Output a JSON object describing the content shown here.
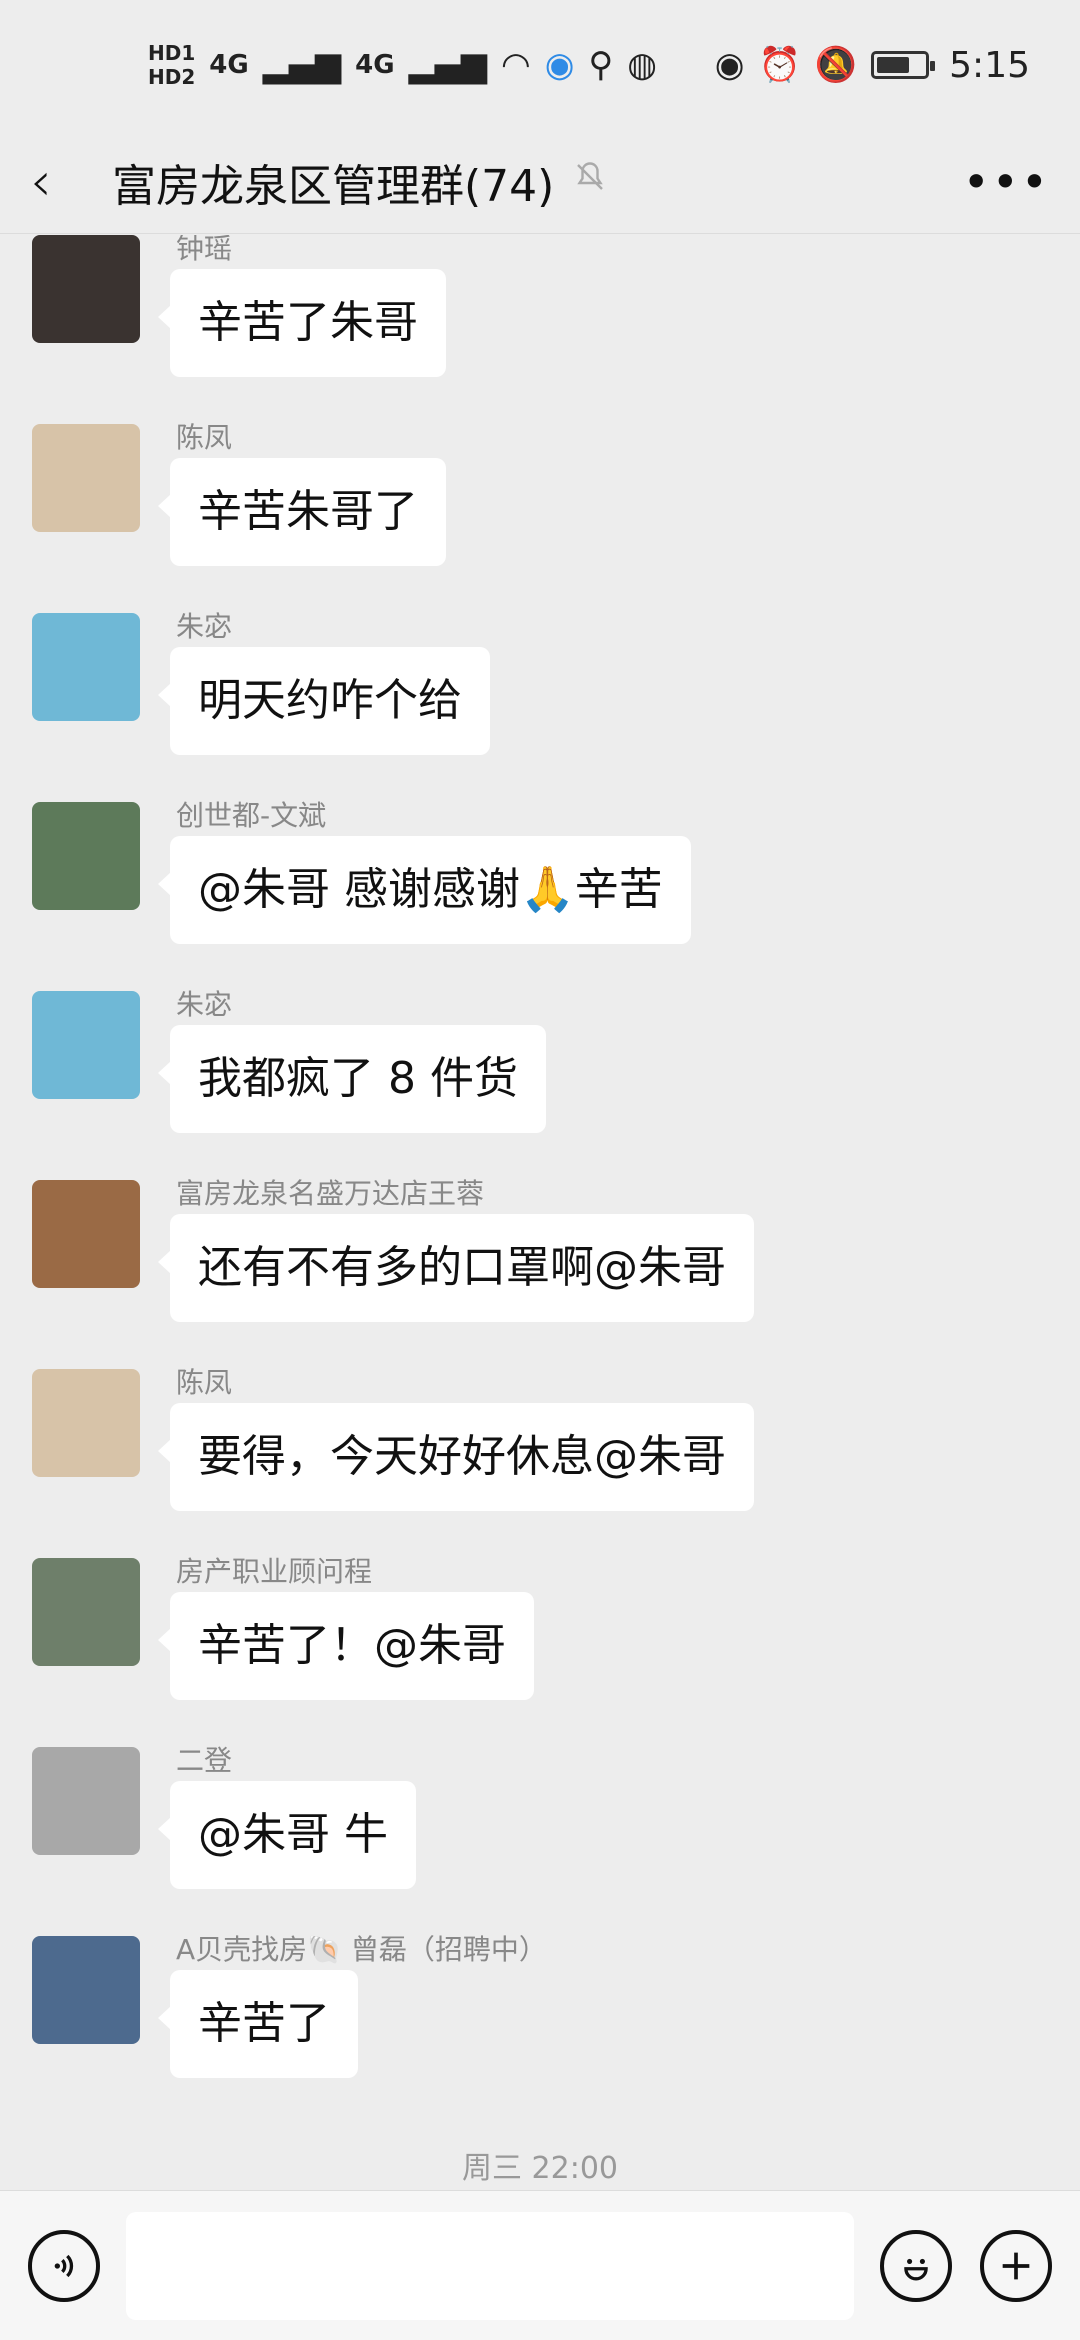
{
  "status_bar": {
    "hd1": "HD1",
    "hd2": "HD2",
    "signal1": "4G",
    "signal2": "4G",
    "time": "5:15"
  },
  "header": {
    "title": "富房龙泉区管理群(74)"
  },
  "messages": [
    {
      "sender": "钟瑶",
      "text": "辛苦了朱哥",
      "avatar_color": "#3a3330"
    },
    {
      "sender": "陈凤",
      "text": "辛苦朱哥了",
      "avatar_color": "#d7c3a8"
    },
    {
      "sender": "朱宓",
      "text": "明天约咋个给",
      "avatar_color": "#6fb8d6"
    },
    {
      "sender": "创世都-文斌",
      "text": "@朱哥  感谢感谢🙏辛苦",
      "avatar_color": "#5d7a5a"
    },
    {
      "sender": "朱宓",
      "text": "我都疯了 8 件货",
      "avatar_color": "#6fb8d6"
    },
    {
      "sender": "富房龙泉名盛万达店王蓉",
      "text": "还有不有多的口罩啊@朱哥",
      "avatar_color": "#9a6a45"
    },
    {
      "sender": "陈凤",
      "text": "要得，今天好好休息@朱哥",
      "avatar_color": "#d7c3a8"
    },
    {
      "sender": "房产职业顾问程",
      "text": "辛苦了！@朱哥",
      "avatar_color": "#6e7f6a"
    },
    {
      "sender": "二登",
      "text": "@朱哥  牛",
      "avatar_color": "#a8a8a8"
    },
    {
      "sender": "A贝壳找房🐚 曾磊（招聘中）",
      "text": "辛苦了",
      "avatar_color": "#4d6a8e"
    }
  ],
  "timestamp": "周三 22:00",
  "icons": {
    "back": "‹",
    "mute": "🔕",
    "more": "•••",
    "voice": "◗",
    "emoji": "☺",
    "add": "+"
  }
}
